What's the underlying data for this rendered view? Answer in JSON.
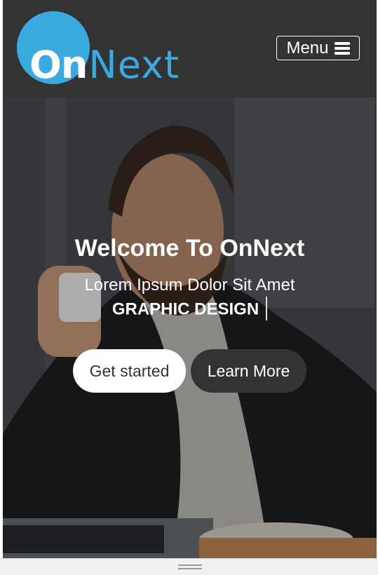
{
  "header": {
    "logo_text_o": "O",
    "logo_text_n": "n",
    "logo_text_next": "Next",
    "menu_label": "Menu",
    "menu_icon": "hamburger-icon"
  },
  "hero": {
    "title": "Welcome To OnNext",
    "subtitle": "Lorem Ipsum Dolor Sit Amet",
    "typed_text": "GRAPHIC DESIGN",
    "primary_button": "Get started",
    "secondary_button": "Learn More"
  },
  "colors": {
    "brand_blue": "#3aa9e0",
    "header_bg": "#333333",
    "button_light": "#ffffff",
    "button_dark": "#333333"
  }
}
